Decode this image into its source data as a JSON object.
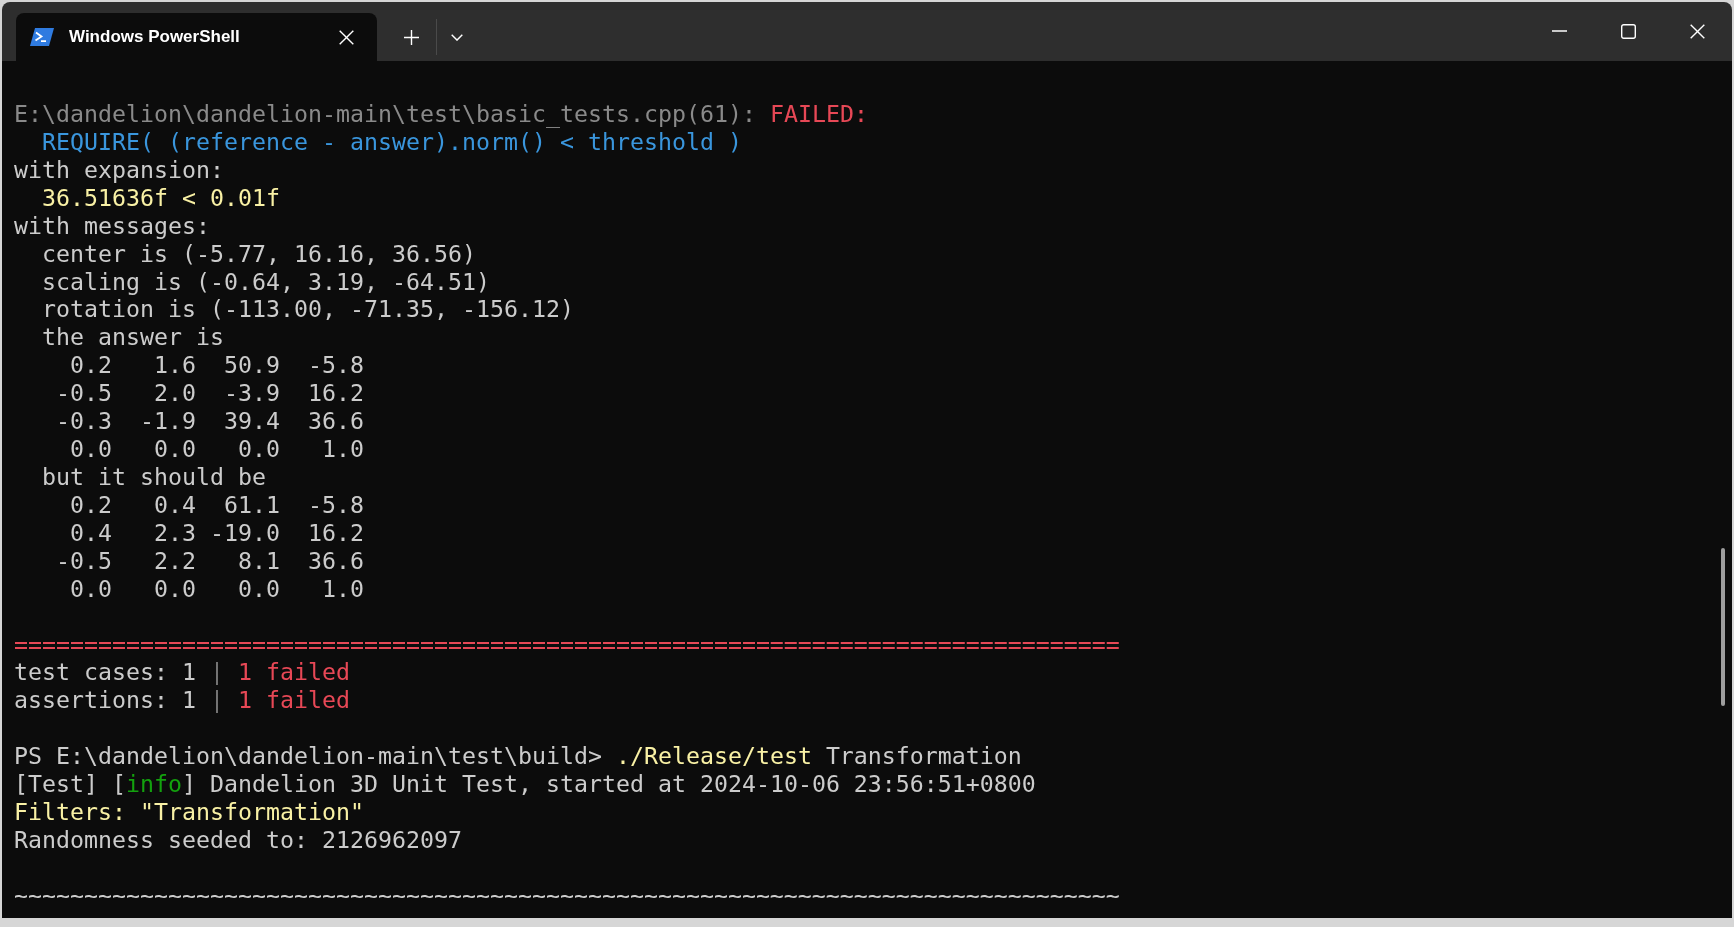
{
  "tabs": [
    {
      "title": "Windows PowerShell",
      "selected": true
    }
  ],
  "terminal": {
    "lines": [
      {
        "kind": "text",
        "segments": [
          {
            "text": "E:\\dandelion\\dandelion-main\\test\\basic_tests.cpp(61): ",
            "color": "#8a8a8a"
          },
          {
            "text": "FAILED:",
            "color": "#e74856"
          }
        ]
      },
      {
        "kind": "text",
        "segments": [
          {
            "text": "  REQUIRE( (reference - answer).norm() < threshold )",
            "color": "#3a96dd"
          }
        ]
      },
      {
        "kind": "text",
        "segments": [
          {
            "text": "with expansion:",
            "color": "#cccccc"
          }
        ]
      },
      {
        "kind": "text",
        "segments": [
          {
            "text": "  36.51636f < 0.01f",
            "color": "#f9f1a5"
          }
        ]
      },
      {
        "kind": "text",
        "segments": [
          {
            "text": "with messages:",
            "color": "#cccccc"
          }
        ]
      },
      {
        "kind": "text",
        "segments": [
          {
            "text": "  center is (-5.77, 16.16, 36.56)",
            "color": "#cccccc"
          }
        ]
      },
      {
        "kind": "text",
        "segments": [
          {
            "text": "  scaling is (-0.64, 3.19, -64.51)",
            "color": "#cccccc"
          }
        ]
      },
      {
        "kind": "text",
        "segments": [
          {
            "text": "  rotation is (-113.00, -71.35, -156.12)",
            "color": "#cccccc"
          }
        ]
      },
      {
        "kind": "text",
        "segments": [
          {
            "text": "  the answer is",
            "color": "#cccccc"
          }
        ]
      },
      {
        "kind": "text",
        "segments": [
          {
            "text": "    0.2   1.6  50.9  -5.8",
            "color": "#cccccc"
          }
        ]
      },
      {
        "kind": "text",
        "segments": [
          {
            "text": "   -0.5   2.0  -3.9  16.2",
            "color": "#cccccc"
          }
        ]
      },
      {
        "kind": "text",
        "segments": [
          {
            "text": "   -0.3  -1.9  39.4  36.6",
            "color": "#cccccc"
          }
        ]
      },
      {
        "kind": "text",
        "segments": [
          {
            "text": "    0.0   0.0   0.0   1.0",
            "color": "#cccccc"
          }
        ]
      },
      {
        "kind": "text",
        "segments": [
          {
            "text": "  but it should be",
            "color": "#cccccc"
          }
        ]
      },
      {
        "kind": "text",
        "segments": [
          {
            "text": "    0.2   0.4  61.1  -5.8",
            "color": "#cccccc"
          }
        ]
      },
      {
        "kind": "text",
        "segments": [
          {
            "text": "    0.4   2.3 -19.0  16.2",
            "color": "#cccccc"
          }
        ]
      },
      {
        "kind": "text",
        "segments": [
          {
            "text": "   -0.5   2.2   8.1  36.6",
            "color": "#cccccc"
          }
        ]
      },
      {
        "kind": "text",
        "segments": [
          {
            "text": "    0.0   0.0   0.0   1.0",
            "color": "#cccccc"
          }
        ]
      },
      {
        "kind": "blank"
      },
      {
        "kind": "text",
        "segments": [
          {
            "text": "===============================================================================",
            "color": "#e74856"
          }
        ]
      },
      {
        "kind": "text",
        "segments": [
          {
            "text": "test cases: 1 ",
            "color": "#cccccc"
          },
          {
            "text": "|",
            "color": "#767676"
          },
          {
            "text": " 1 failed",
            "color": "#e74856"
          }
        ]
      },
      {
        "kind": "text",
        "segments": [
          {
            "text": "assertions: 1 ",
            "color": "#cccccc"
          },
          {
            "text": "|",
            "color": "#767676"
          },
          {
            "text": " 1 failed",
            "color": "#e74856"
          }
        ]
      },
      {
        "kind": "blank"
      },
      {
        "kind": "text",
        "segments": [
          {
            "text": "PS E:\\dandelion\\dandelion-main\\test\\build> ",
            "color": "#cccccc"
          },
          {
            "text": "./Release/test",
            "color": "#f9f1a5"
          },
          {
            "text": " Transformation",
            "color": "#cccccc"
          }
        ]
      },
      {
        "kind": "text",
        "segments": [
          {
            "text": "[Test] [",
            "color": "#cccccc"
          },
          {
            "text": "info",
            "color": "#13a10e"
          },
          {
            "text": "] Dandelion 3D Unit Test, started at 2024-10-06 23:56:51+0800",
            "color": "#cccccc"
          }
        ]
      },
      {
        "kind": "text",
        "segments": [
          {
            "text": "Filters: \"Transformation\"",
            "color": "#f9f1a5"
          }
        ]
      },
      {
        "kind": "text",
        "segments": [
          {
            "text": "Randomness seeded to: 2126962097",
            "color": "#cccccc"
          }
        ]
      },
      {
        "kind": "blank"
      },
      {
        "kind": "text",
        "segments": [
          {
            "text": "~~~~~~~~~~~~~~~~~~~~~~~~~~~~~~~~~~~~~~~~~~~~~~~~~~~~~~~~~~~~~~~~~~~~~~~~~~~~~~~",
            "color": "#cccccc"
          }
        ]
      }
    ]
  }
}
